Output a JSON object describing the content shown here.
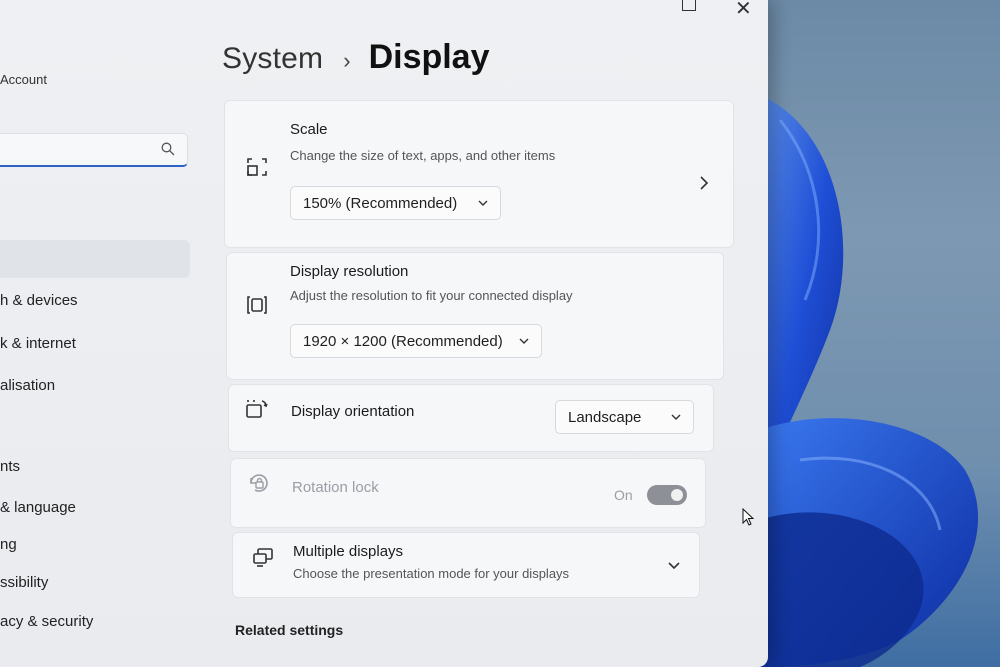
{
  "window": {
    "account_label": "Account"
  },
  "search": {
    "placeholder": ""
  },
  "sidebar": {
    "items": [
      {
        "label": "h & devices"
      },
      {
        "label": "k & internet"
      },
      {
        "label": "alisation"
      },
      {
        "label": "nts"
      },
      {
        "label": "& language"
      },
      {
        "label": "ng"
      },
      {
        "label": "ssibility"
      },
      {
        "label": "acy & security"
      }
    ]
  },
  "breadcrumb": {
    "parent": "System",
    "separator": "›",
    "current": "Display"
  },
  "scale": {
    "title": "Scale",
    "description": "Change the size of text, apps, and other items",
    "value": "150% (Recommended)"
  },
  "resolution": {
    "title": "Display resolution",
    "description": "Adjust the resolution to fit your connected display",
    "value": "1920 × 1200 (Recommended)"
  },
  "orientation": {
    "title": "Display orientation",
    "value": "Landscape"
  },
  "rotation_lock": {
    "title": "Rotation lock",
    "state_label": "On",
    "enabled": false
  },
  "multiple_displays": {
    "title": "Multiple displays",
    "description": "Choose the presentation mode for your displays"
  },
  "related_settings": {
    "heading": "Related settings"
  },
  "colors": {
    "accent": "#2c63c5",
    "wallpaper_bloom": "#1f4fd6"
  }
}
